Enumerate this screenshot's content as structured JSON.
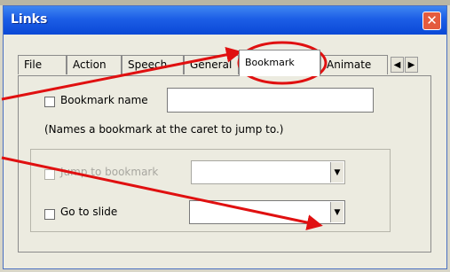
{
  "window": {
    "title": "Links"
  },
  "tabs": [
    {
      "label": "File"
    },
    {
      "label": "Action"
    },
    {
      "label": "Speech"
    },
    {
      "label": "General"
    },
    {
      "label": "Bookmark",
      "active": true
    },
    {
      "label": "Animate"
    }
  ],
  "tab_scroll": {
    "left_icon": "arrow-left-icon",
    "right_icon": "arrow-right-icon"
  },
  "bookmark_panel": {
    "bookmark_name_label": "Bookmark name",
    "bookmark_name_value": "",
    "description": "(Names a bookmark at the caret to jump to.)",
    "jump_to_bookmark_label": "Jump to bookmark",
    "jump_to_bookmark_value": "",
    "go_to_slide_label": "Go to slide",
    "go_to_slide_value": ""
  },
  "annotation_colors": {
    "arrow": "#e01010",
    "circle": "#e01010"
  },
  "icons": {
    "close": "close-icon",
    "dropdown": "chevron-down-icon"
  }
}
